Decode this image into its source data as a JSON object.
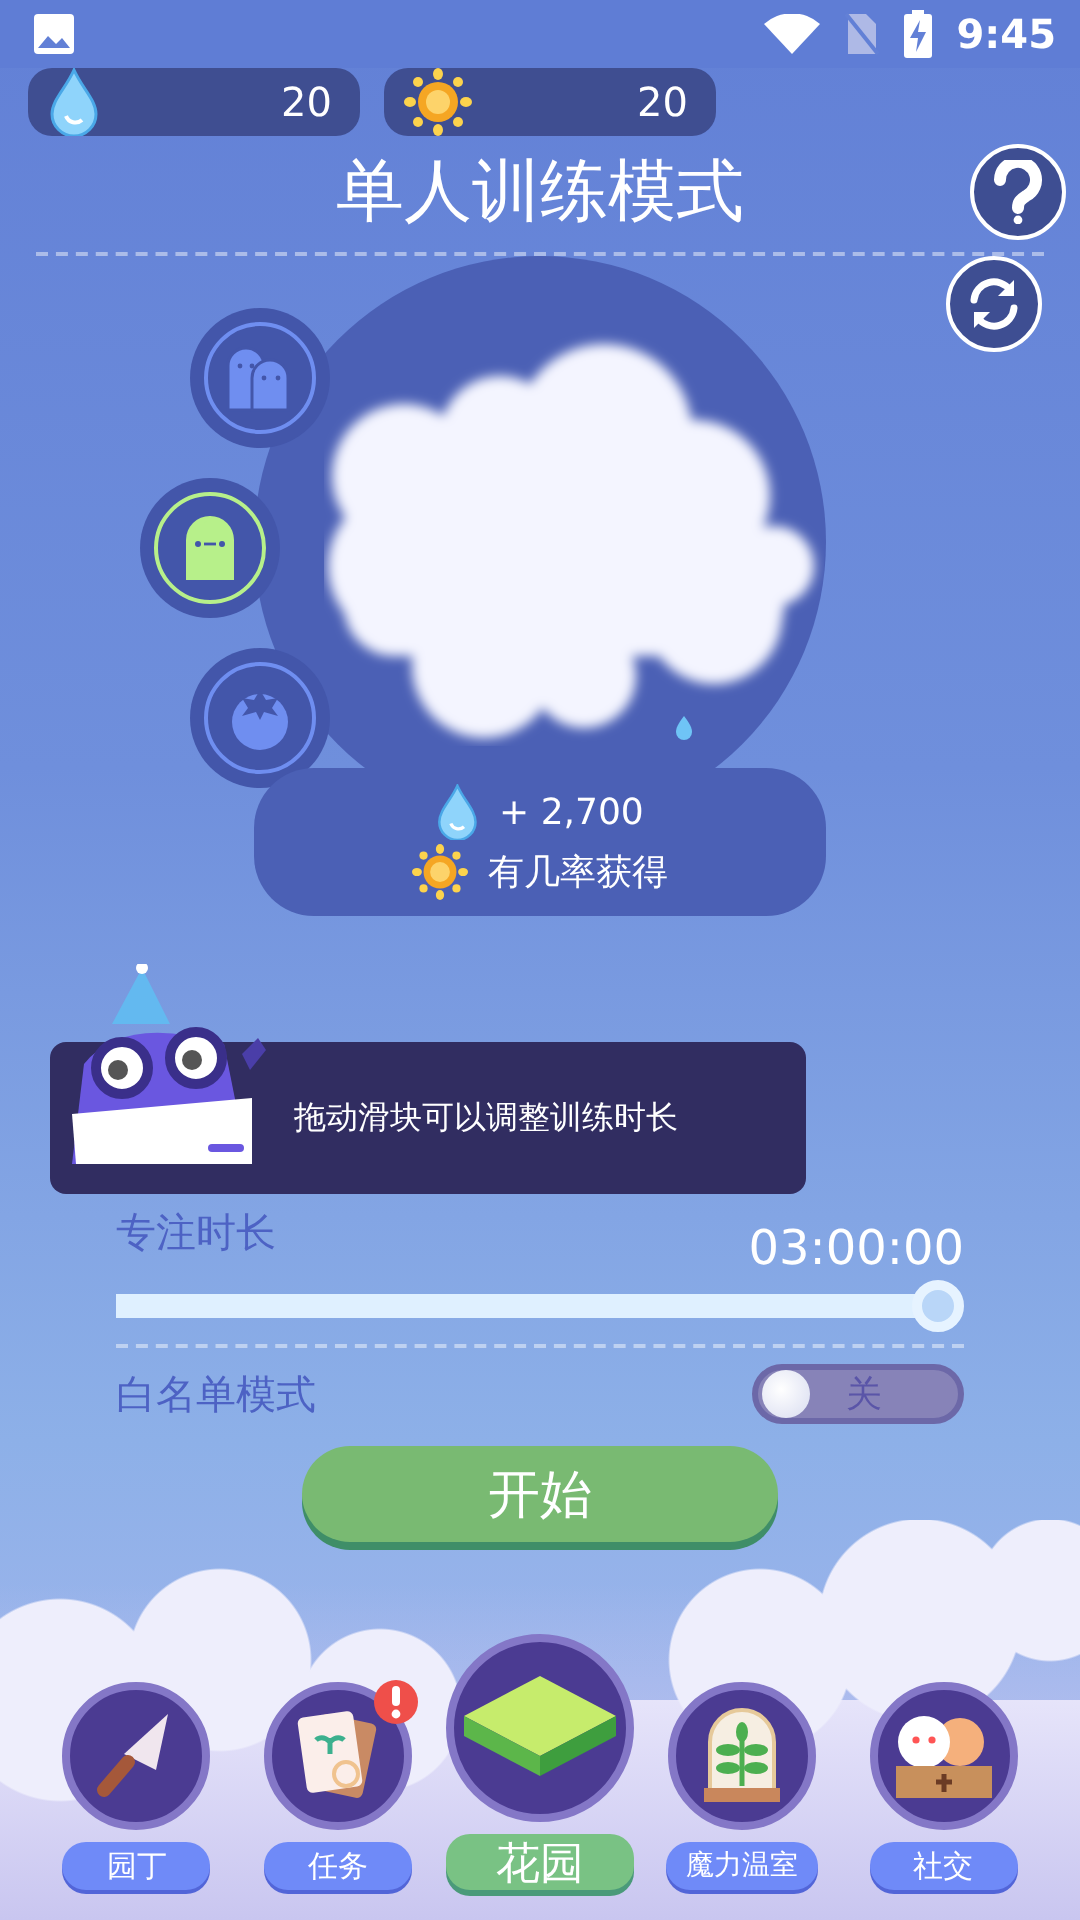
{
  "status_bar": {
    "time": "9:45"
  },
  "currencies": [
    {
      "kind": "water",
      "amount": "20"
    },
    {
      "kind": "sun",
      "amount": "20"
    }
  ],
  "title": "单人训练模式",
  "modes": [
    {
      "kind": "pair",
      "selected": false
    },
    {
      "kind": "single",
      "selected": true
    },
    {
      "kind": "fruit",
      "selected": false
    }
  ],
  "reward": {
    "water": "+ 2,700",
    "sun": "有几率获得"
  },
  "tip": "拖动滑块可以调整训练时长",
  "duration": {
    "label": "专注时长",
    "value": "03:00:00",
    "level": 1.0
  },
  "whitelist": {
    "label": "白名单模式",
    "on": false,
    "state_text": "关"
  },
  "start_button": "开始",
  "nav": [
    {
      "kind": "trowel",
      "label": "园丁",
      "selected": false,
      "alert": false
    },
    {
      "kind": "tasks",
      "label": "任务",
      "selected": false,
      "alert": true
    },
    {
      "kind": "garden",
      "label": "花园",
      "selected": true,
      "alert": false
    },
    {
      "kind": "greenhouse",
      "label": "魔力温室",
      "selected": false,
      "alert": false
    },
    {
      "kind": "social",
      "label": "社交",
      "selected": false,
      "alert": false
    }
  ]
}
